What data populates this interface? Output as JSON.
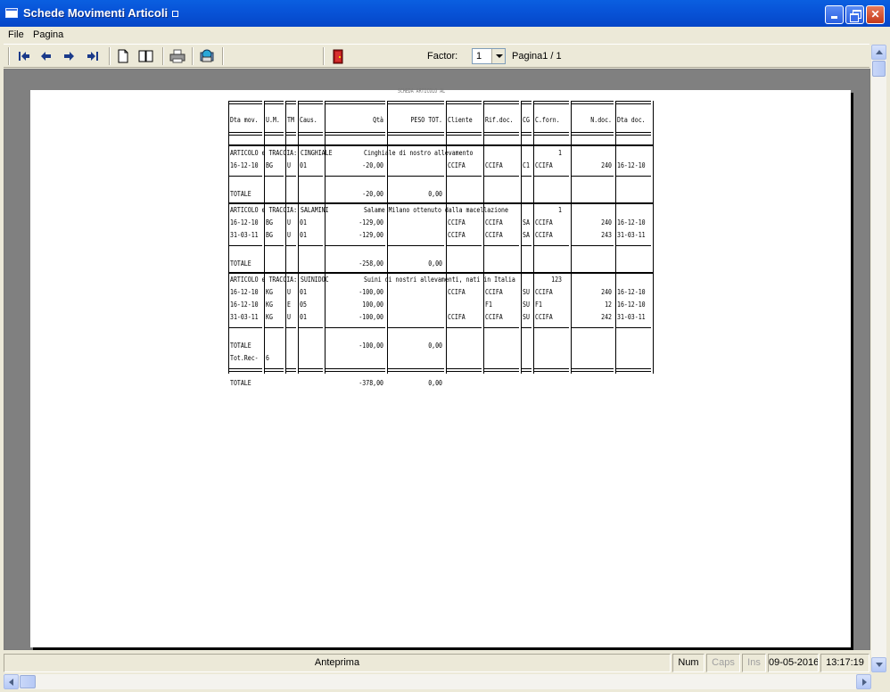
{
  "window": {
    "title": "Schede Movimenti Articoli"
  },
  "menu": [
    "File",
    "Pagina"
  ],
  "toolbar": {
    "factor_label": "Factor:",
    "factor_value": "1",
    "page_label": "Pagina1 / 1",
    "icons": [
      "first-page-icon",
      "prev-page-icon",
      "next-page-icon",
      "last-page-icon",
      "single-page-icon",
      "two-pages-icon",
      "printer-icon",
      "setup-icon",
      "exit-door-icon"
    ]
  },
  "status": {
    "center": "Anteprima",
    "num": "Num",
    "caps": "Caps",
    "ins": "Ins",
    "date": "09-05-2016",
    "time": "13:17:19"
  },
  "report": {
    "top_heading": "SCHEDA ARTICOLO AL",
    "columns": [
      "Dta mov.",
      "U.M.",
      "TM",
      "Caus.",
      "Qtà",
      "PESO TOT.",
      "Cliente",
      "Rif.doc.",
      "CG",
      "C.forn.",
      "N.doc.",
      "Dta doc."
    ],
    "groups": [
      {
        "header": "ARTICOLO e TRACCIA: CINGHIALE",
        "description": "Cinghiale di nostro allevamento",
        "code": "1",
        "rows": [
          {
            "dta_mov": "16-12-10",
            "um": "BG",
            "tm": "U",
            "caus": "01",
            "qta": "-20,00",
            "peso": "",
            "cliente": "CCIFA",
            "rif": "CCIFA",
            "cg": "C1",
            "cforn": "CCIFA",
            "ndoc": "240",
            "dta_doc": "16-12-10"
          }
        ],
        "totale_label": "TOTALE",
        "totale_qta": "-20,00",
        "totale_peso": "0,00"
      },
      {
        "header": "ARTICOLO e TRACCIA: SALAMINI",
        "description": "Salame Milano ottenuto dalla macellazione",
        "code": "1",
        "rows": [
          {
            "dta_mov": "16-12-10",
            "um": "BG",
            "tm": "U",
            "caus": "01",
            "qta": "-129,00",
            "peso": "",
            "cliente": "CCIFA",
            "rif": "CCIFA",
            "cg": "SA",
            "cforn": "CCIFA",
            "ndoc": "240",
            "dta_doc": "16-12-10"
          },
          {
            "dta_mov": "31-03-11",
            "um": "BG",
            "tm": "U",
            "caus": "01",
            "qta": "-129,00",
            "peso": "",
            "cliente": "CCIFA",
            "rif": "CCIFA",
            "cg": "SA",
            "cforn": "CCIFA",
            "ndoc": "243",
            "dta_doc": "31-03-11"
          }
        ],
        "totale_label": "TOTALE",
        "totale_qta": "-258,00",
        "totale_peso": "0,00"
      },
      {
        "header": "ARTICOLO e TRACCIA: SUINIDOC",
        "description": "Suini di nostri allevamenti, nati in Italia",
        "code": "123",
        "rows": [
          {
            "dta_mov": "16-12-10",
            "um": "KG",
            "tm": "U",
            "caus": "01",
            "qta": "-100,00",
            "peso": "",
            "cliente": "CCIFA",
            "rif": "CCIFA",
            "cg": "SU",
            "cforn": "CCIFA",
            "ndoc": "240",
            "dta_doc": "16-12-10"
          },
          {
            "dta_mov": "16-12-10",
            "um": "KG",
            "tm": "E",
            "caus": "05",
            "qta": "100,00",
            "peso": "",
            "cliente": "",
            "rif": "F1",
            "cg": "SU",
            "cforn": "F1",
            "ndoc": "12",
            "dta_doc": "16-12-10"
          },
          {
            "dta_mov": "31-03-11",
            "um": "KG",
            "tm": "U",
            "caus": "01",
            "qta": "-100,00",
            "peso": "",
            "cliente": "CCIFA",
            "rif": "CCIFA",
            "cg": "SU",
            "cforn": "CCIFA",
            "ndoc": "242",
            "dta_doc": "31-03-11"
          }
        ],
        "totale_label": "TOTALE",
        "totale_qta": "-100,00",
        "totale_peso": "0,00",
        "tot_rec_label": "Tot.Rec-",
        "tot_rec_value": "6"
      }
    ],
    "grand_total_label": "TOTALE",
    "grand_total_qta": "-378,00",
    "grand_total_peso": "0,00"
  }
}
